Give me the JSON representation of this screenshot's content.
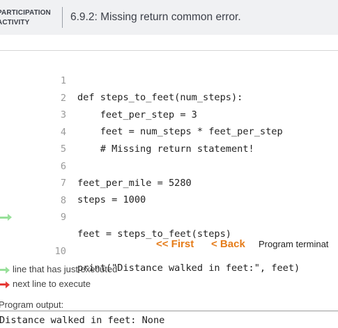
{
  "header": {
    "activity_type": "PARTICIPATION ACTIVITY",
    "title": "6.9.2: Missing return common error."
  },
  "code": {
    "lines": [
      {
        "no": "1",
        "text": "def steps_to_feet(num_steps):"
      },
      {
        "no": "2",
        "text": "    feet_per_step = 3"
      },
      {
        "no": "3",
        "text": "    feet = num_steps * feet_per_step"
      },
      {
        "no": "4",
        "text": "    # Missing return statement!"
      },
      {
        "no": "5",
        "text": ""
      },
      {
        "no": "6",
        "text": "feet_per_mile = 5280"
      },
      {
        "no": "7",
        "text": "steps = 1000"
      },
      {
        "no": "8",
        "text": ""
      },
      {
        "no": "9",
        "text": "feet = steps_to_feet(steps)"
      },
      {
        "no": "10",
        "text": "print(\"Distance walked in feet:\", feet)"
      }
    ],
    "just_executed_line": "10"
  },
  "controls": {
    "first_label": "<< First",
    "back_label": "< Back",
    "status": "Program terminat"
  },
  "legend": {
    "just_executed": "line that has just executed",
    "next_line": "next line to execute"
  },
  "output": {
    "label": "Program output:",
    "text": "Distance walked in feet: None"
  },
  "colors": {
    "accent": "#e57c1a",
    "just_executed_arrow": "#98e09a",
    "next_line_arrow": "#e53935"
  }
}
